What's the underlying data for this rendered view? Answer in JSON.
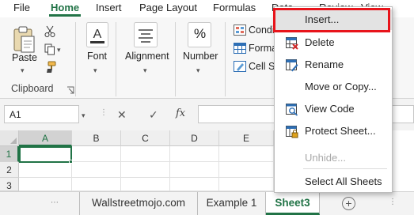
{
  "ribbon_tabs": [
    "File",
    "Home",
    "Insert",
    "Page Layout",
    "Formulas",
    "Data",
    "Review",
    "View"
  ],
  "ribbon": {
    "paste_label": "Paste",
    "clipboard_label": "Clipboard",
    "font_label": "Font",
    "alignment_label": "Alignment",
    "number_label": "Number",
    "percent_symbol": "%",
    "conditional_label": "Condi",
    "format_label": "Forma",
    "cellstyles_label": "Cell St"
  },
  "formula_bar": {
    "name_box": "A1",
    "fx": "fx",
    "value": ""
  },
  "grid": {
    "columns": [
      "A",
      "B",
      "C",
      "D",
      "E"
    ],
    "rows": [
      "1",
      "2",
      "3"
    ],
    "active_cell": "A1"
  },
  "sheet_tabs": [
    "Wallstreetmojo.com",
    "Example 1",
    "Sheet3"
  ],
  "active_sheet": "Sheet3",
  "context_menu": {
    "insert": "Insert...",
    "delete": "Delete",
    "rename": "Rename",
    "move_copy": "Move or Copy...",
    "view_code": "View Code",
    "protect_sheet": "Protect Sheet...",
    "unhide": "Unhide...",
    "select_all_sheets": "Select All Sheets"
  },
  "colors": {
    "excel_green": "#217346",
    "highlight_red": "#e8141b"
  }
}
